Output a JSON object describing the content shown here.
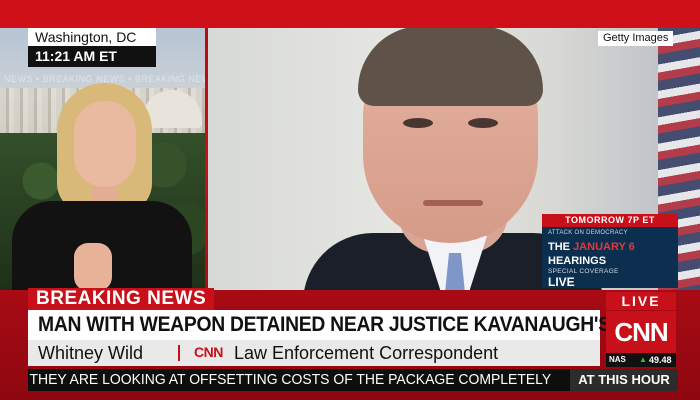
{
  "location": {
    "city": "Washington, DC",
    "time": "11:21 AM ET"
  },
  "faded_ticker": "NEWS • BREAKING NEWS • BREAKING NEWS",
  "photo_credit": "Getty Images",
  "promo": {
    "header": "TOMORROW 7P ET",
    "kicker": "ATTACK ON DEMOCRACY",
    "title_part1": "THE ",
    "title_part2": "JANUARY 6",
    "title_line2": "HEARINGS",
    "sub": "SPECIAL COVERAGE",
    "status": "LIVE"
  },
  "lower_third": {
    "label": "BREAKING NEWS",
    "headline": "MAN WITH WEAPON DETAINED NEAR JUSTICE KAVANAUGH'S HOME",
    "name": "Whitney Wild",
    "network": "CNN",
    "role": "Law Enforcement Correspondent"
  },
  "live_block": {
    "live": "LIVE",
    "logo": "CNN",
    "market_name": "NAS",
    "market_arrow": "▲",
    "market_value": "49.48"
  },
  "ticker": {
    "text": "I THEY ARE LOOKING AT OFFSETTING COSTS OF THE PACKAGE COMPLETELY",
    "tag": "AT THIS HOUR"
  },
  "colors": {
    "cnn_red": "#c8101a",
    "promo_blue": "#0c2f4f",
    "market_up": "#27c04a"
  }
}
